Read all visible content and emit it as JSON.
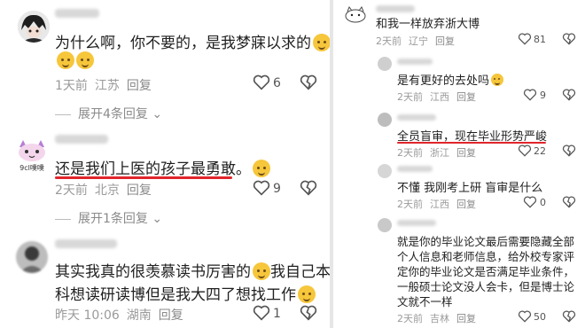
{
  "left": {
    "comments": [
      {
        "text_line1": "为什么啊，你不要的，是我梦寐以求的",
        "emoji_line2": true,
        "time": "1天前",
        "location": "江苏",
        "reply": "回复",
        "likes": "6"
      },
      {
        "text_line1": "还是我们上医的孩子最勇敢。",
        "time": "2天前",
        "location": "北京",
        "reply": "回复",
        "likes": "9"
      },
      {
        "text_line1": "其实我真的很羡慕读书厉害的",
        "text_line1_b": "我自己本",
        "text_line2": "科想读研读博但是我大四了想找工作",
        "time": "昨天 10:06",
        "location": "湖南",
        "reply": "回复",
        "likes": "1"
      }
    ],
    "expand1": "展开4条回复",
    "expand2": "展开1条回复",
    "avatar2_caption": "9cl噗噗"
  },
  "right": {
    "top_comment": {
      "text": "和我一样放弃浙大博",
      "time": "2天前",
      "location": "辽宁",
      "reply": "回复",
      "likes": "81"
    },
    "replies": [
      {
        "text": "是有更好的去处吗",
        "time": "2天前",
        "location": "江西",
        "reply": "回复",
        "likes": "9"
      },
      {
        "text": "全员盲审，现在毕业形势严峻",
        "time": "2天前",
        "location": "浙江",
        "reply": "回复",
        "likes": "22"
      },
      {
        "text": "不懂 我刚考上研 盲审是什么",
        "time": "2天前",
        "location": "江西",
        "reply": "回复",
        "likes": "0"
      },
      {
        "lines": [
          "就是你的毕业论文最后需要隐藏全部",
          "个人信息和老师信息，给外校专家评",
          "定你的毕业论文是否满足毕业条件，",
          "一般硕士论文没人会卡，但是博士论",
          "文就不一样"
        ],
        "time": "2天前",
        "location": "吉林",
        "reply": "回复",
        "likes": "50"
      }
    ]
  },
  "colors": {
    "underline": "#e0262b",
    "meta": "#9a9a9a",
    "text": "#1f1f1f"
  }
}
